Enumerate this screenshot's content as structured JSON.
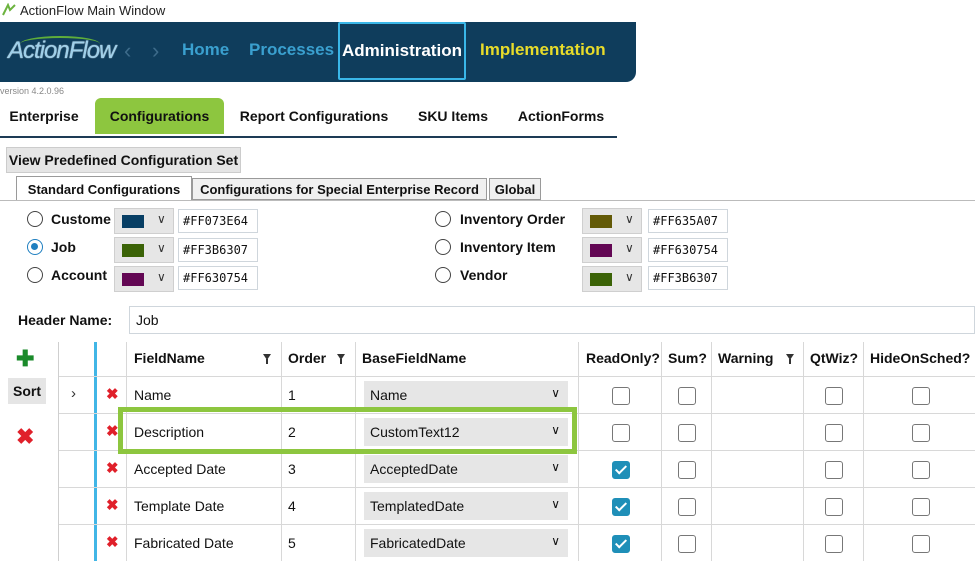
{
  "window": {
    "title": "ActionFlow Main Window"
  },
  "app": {
    "logo": "ActionFlow",
    "version": "version 4.2.0.96",
    "nav": {
      "home": "Home",
      "processes": "Processes",
      "administration": "Administration",
      "implementation": "Implementation"
    }
  },
  "tabs": [
    "Enterprise",
    "Configurations",
    "Report Configurations",
    "SKU Items",
    "ActionForms"
  ],
  "active_tab": "Configurations",
  "view_button": "View Predefined Configuration Set",
  "subtabs": [
    "Standard Configurations",
    "Configurations for Special Enterprise Record",
    "Global"
  ],
  "active_subtab": "Standard Configurations",
  "color_options": [
    {
      "label": "Custome",
      "hex": "#FF073E64",
      "color": "#073E64",
      "selected": false
    },
    {
      "label": "Job",
      "hex": "#FF3B6307",
      "color": "#3B6307",
      "selected": true
    },
    {
      "label": "Account",
      "hex": "#FF630754",
      "color": "#630754",
      "selected": false
    },
    {
      "label": "Inventory Order",
      "hex": "#FF635A07",
      "color": "#635A07",
      "selected": false
    },
    {
      "label": "Inventory Item",
      "hex": "#FF630754",
      "color": "#630754",
      "selected": false
    },
    {
      "label": "Vendor",
      "hex": "#FF3B6307",
      "color": "#3B6307",
      "selected": false
    }
  ],
  "header_name": {
    "label": "Header Name:",
    "value": "Job"
  },
  "side": {
    "sort": "Sort"
  },
  "grid": {
    "columns": [
      "FieldName",
      "Order",
      "BaseFieldName",
      "ReadOnly?",
      "Sum?",
      "Warning",
      "QtWiz?",
      "HideOnSched?"
    ],
    "rows": [
      {
        "field": "Name",
        "order": "1",
        "base": "Name",
        "readonly": false,
        "sum": false,
        "qtwiz": false,
        "hide": false
      },
      {
        "field": "Description",
        "order": "2",
        "base": "CustomText12",
        "readonly": false,
        "sum": false,
        "qtwiz": false,
        "hide": false
      },
      {
        "field": "Accepted Date",
        "order": "3",
        "base": "AcceptedDate",
        "readonly": true,
        "sum": false,
        "qtwiz": false,
        "hide": false
      },
      {
        "field": "Template Date",
        "order": "4",
        "base": "TemplatedDate",
        "readonly": true,
        "sum": false,
        "qtwiz": false,
        "hide": false
      },
      {
        "field": "Fabricated Date",
        "order": "5",
        "base": "FabricatedDate",
        "readonly": true,
        "sum": false,
        "qtwiz": false,
        "hide": false
      }
    ]
  },
  "colors": {
    "accent_green": "#8dc63f",
    "nav_bg": "#0f3d5c",
    "selection_blue": "#41b6e6"
  }
}
